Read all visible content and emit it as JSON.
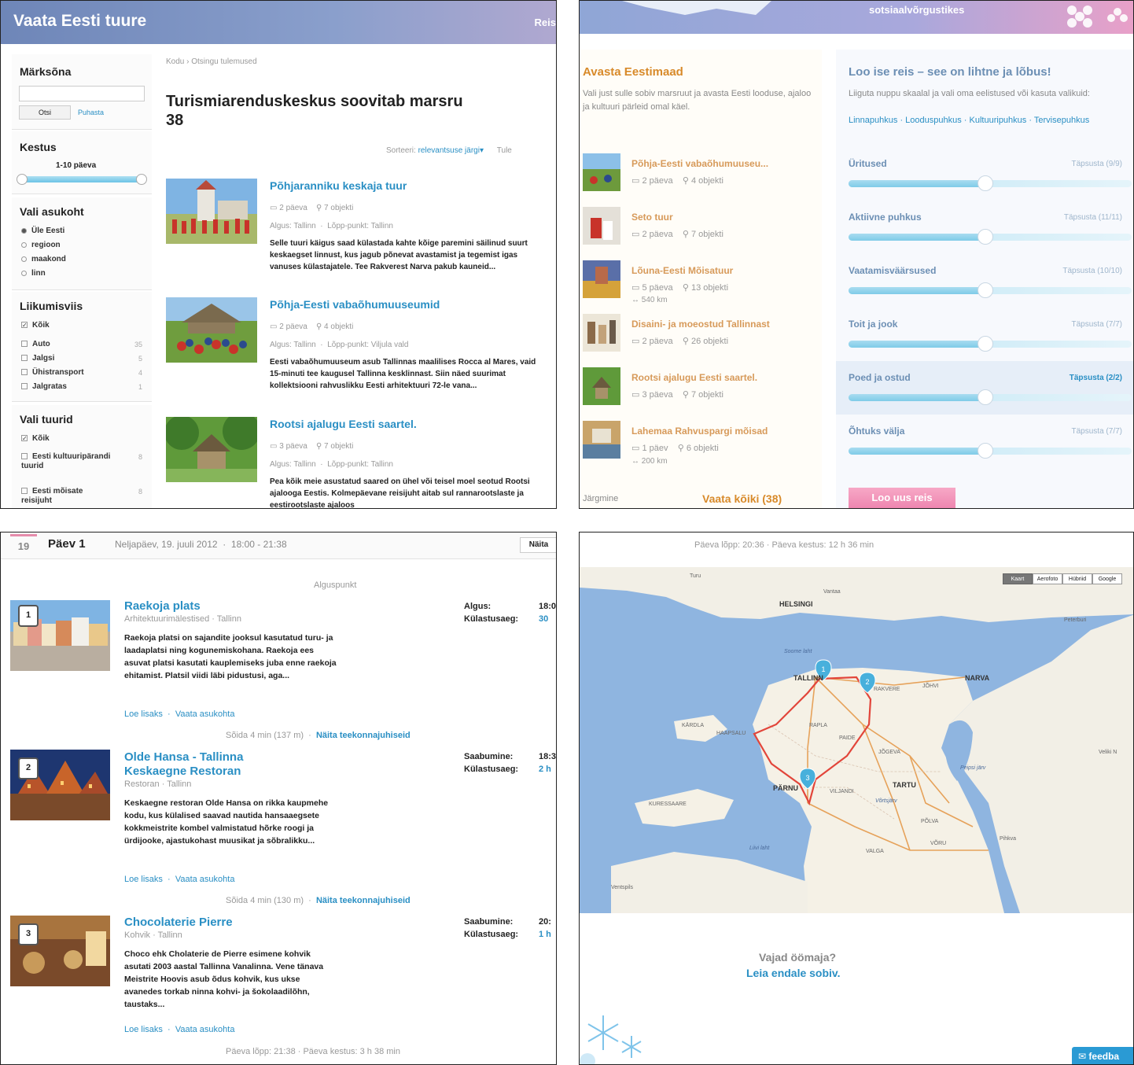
{
  "q1": {
    "banner_title": "Vaata Eesti tuure",
    "banner_right": "Reis",
    "sidebar": {
      "keyword_heading": "Märksõna",
      "search_button": "Otsi",
      "clear_link": "Puhasta",
      "duration_heading": "Kestus",
      "duration_value": "1-10 päeva",
      "location_heading": "Vali asukoht",
      "location_options": [
        "Üle Eesti",
        "regioon",
        "maakond",
        "linn"
      ],
      "transport_heading": "Liikumisviis",
      "transport_options": [
        {
          "label": "Kõik",
          "count": ""
        },
        {
          "label": "Auto",
          "count": "35"
        },
        {
          "label": "Jalgsi",
          "count": "5"
        },
        {
          "label": "Ühistransport",
          "count": "4"
        },
        {
          "label": "Jalgratas",
          "count": "1"
        }
      ],
      "tours_heading": "Vali tuurid",
      "tour_options": [
        {
          "label": "Kõik",
          "count": ""
        },
        {
          "label": "Eesti kultuuripärandi tuurid",
          "count": "8"
        },
        {
          "label": "Eesti mõisate reisijuht",
          "count": "8"
        }
      ]
    },
    "breadcrumb": [
      "Kodu",
      "Otsingu tulemused"
    ],
    "heading_line1": "Turismiarenduskeskus soovitab marsru",
    "heading_line2": "38",
    "sort_label": "Sorteeri:",
    "sort_value": "relevantsuse järgi",
    "sort_extra": "Tule",
    "tours": [
      {
        "title": "Põhjaranniku keskaja tuur",
        "days": "2 päeva",
        "objects": "7 objekti",
        "start": "Algus: Tallinn",
        "end": "Lõpp-punkt: Tallinn",
        "desc": "Selle tuuri käigus saad külastada kahte kõige paremini säilinud suurt keskaegset linnust, kus jagub põnevat avastamist ja tegemist igas vanuses külastajatele. Tee Rakverest Narva pakub kauneid..."
      },
      {
        "title": "Põhja-Eesti vabaõhumuuseumid",
        "days": "2 päeva",
        "objects": "4 objekti",
        "start": "Algus: Tallinn",
        "end": "Lõpp-punkt: Viljula vald",
        "desc": "Eesti vabaõhumuuseum asub Tallinnas maalilises Rocca al Mares, vaid 15-minuti tee kaugusel Tallinna kesklinnast. Siin näed suurimat kollektsiooni rahvuslikku Eesti arhitektuuri 72-le vana..."
      },
      {
        "title": "Rootsi ajalugu Eesti saartel.",
        "days": "3 päeva",
        "objects": "7 objekti",
        "start": "Algus: Tallinn",
        "end": "Lõpp-punkt: Tallinn",
        "desc": "Pea kõik meie asustatud saared on ühel või teisel moel seotud Rootsi ajalooga Eestis. Kolmepäevane reisijuht aitab sul rannarootslaste ja eestirootslaste ajaloos"
      }
    ]
  },
  "q2": {
    "banner_text": "sotsiaalvõrgustikes",
    "left_title": "Avasta Eestimaad",
    "left_desc": "Vali just sulle sobiv marsruut ja avasta Eesti looduse, ajaloo ja kultuuri pärleid omal käel.",
    "tours": [
      {
        "title": "Põhja-Eesti vabaõhumuuseu...",
        "days": "2 päeva",
        "objects": "4 objekti",
        "km": ""
      },
      {
        "title": "Seto tuur",
        "days": "2 päeva",
        "objects": "7 objekti",
        "km": ""
      },
      {
        "title": "Lõuna-Eesti Mõisatuur",
        "days": "5 päeva",
        "objects": "13 objekti",
        "km": "540 km"
      },
      {
        "title": "Disaini- ja moeostud Tallinnast",
        "days": "2 päeva",
        "objects": "26 objekti",
        "km": ""
      },
      {
        "title": "Rootsi ajalugu Eesti saartel.",
        "days": "3 päeva",
        "objects": "7 objekti",
        "km": ""
      },
      {
        "title": "Lahemaa Rahvuspargi mõisad",
        "days": "1 päev",
        "objects": "6 objekti",
        "km": "200 km"
      }
    ],
    "next_label": "Järgmine",
    "see_all": "Vaata kõiki (38)",
    "right_title": "Loo ise reis – see on lihtne ja lõbus!",
    "right_desc": "Liiguta nuppu skaalal ja vali oma eelistused või kasuta valikuid:",
    "quick_links": [
      "Linnapuhkus",
      "Looduspuhkus",
      "Kultuuripuhkus",
      "Tervisepuhkus"
    ],
    "categories": [
      {
        "name": "Üritused",
        "link": "Täpsusta (9/9)",
        "level": 0.5
      },
      {
        "name": "Aktiivne puhkus",
        "link": "Täpsusta (11/11)",
        "level": 0.5
      },
      {
        "name": "Vaatamisväärsused",
        "link": "Täpsusta (10/10)",
        "level": 0.5
      },
      {
        "name": "Toit ja jook",
        "link": "Täpsusta (7/7)",
        "level": 0.5
      },
      {
        "name": "Poed ja ostud",
        "link": "Täpsusta (2/2)",
        "level": 0.5
      },
      {
        "name": "Õhtuks välja",
        "link": "Täpsusta (7/7)",
        "level": 0.5
      }
    ],
    "create_button": "Loo uus reis"
  },
  "q3": {
    "day_num": "19",
    "day_label": "Päev 1",
    "day_date": "Neljapäev, 19. juuli 2012",
    "day_time": "18:00 - 21:38",
    "show_button": "Näita",
    "start_point": "Alguspunkt",
    "pois": [
      {
        "num": "1",
        "title1": "Raekoja plats",
        "title2": "",
        "sub": "Arhitektuurimälestised · Tallinn",
        "desc": "Raekoja platsi on sajandite jooksul kasutatud turu- ja laadaplatsi ning kogunemiskohana. Raekoja ees asuvat platsi kasutati kauplemiseks juba enne raekoja ehitamist. Platsil viidi läbi pidustusi, aga...",
        "read_more": "Loe lisaks",
        "see_location": "Vaata asukohta",
        "r1_label": "Algus:",
        "r1_val": "18:0",
        "r2_label": "Külastusaeg:",
        "r2_val": "30"
      },
      {
        "num": "2",
        "title1": "Olde Hansa - Tallinna",
        "title2": "Keskaegne Restoran",
        "sub": "Restoran · Tallinn",
        "desc": "Keskaegne restoran Olde Hansa on rikka kaupmehe kodu, kus külalised saavad nautida hansaaegsete kokkmeistrite kombel valmistatud hõrke roogi ja ürdijooke, ajastukohast muusikat ja sõbralikku...",
        "read_more": "Loe lisaks",
        "see_location": "Vaata asukohta",
        "r1_label": "Saabumine:",
        "r1_val": "18:3",
        "r2_label": "Külastusaeg:",
        "r2_val": "2 h"
      },
      {
        "num": "3",
        "title1": "Chocolaterie Pierre",
        "title2": "",
        "sub": "Kohvik · Tallinn",
        "desc": "Choco ehk Cholaterie de Pierre esimene kohvik asutati 2003 aastal Tallinna Vanalinna. Vene tänava Meistrite Hoovis asub õdus kohvik, kus ukse avanedes torkab ninna kohvi- ja šokolaadilõhn, taustaks...",
        "read_more": "Loe lisaks",
        "see_location": "Vaata asukohta",
        "r1_label": "Saabumine:",
        "r1_val": "20:",
        "r2_label": "Külastusaeg:",
        "r2_val": "1 h"
      }
    ],
    "walks": [
      {
        "text": "Sõida 4 min (137 m)",
        "link": "Näita teekonnajuhiseid"
      },
      {
        "text": "Sõida 4 min (130 m)",
        "link": "Näita teekonnajuhiseid"
      }
    ],
    "day_end": "Päeva lõpp: 21:38 · Päeva kestus: 3 h 38 min"
  },
  "q4": {
    "top_text": "Päeva lõpp: 20:36 · Päeva kestus: 12 h 36 min",
    "map_types": [
      "Kaart",
      "Aerofoto",
      "Hübriid",
      "Google"
    ],
    "cities_big": [
      "TALLINN",
      "NARVA",
      "TARTU",
      "PÄRNU",
      "HELSINGI"
    ],
    "cities_small": [
      "Turu",
      "Vantaa",
      "Peterburi",
      "RAKVERE",
      "JÕHVI",
      "KÄRDLA",
      "HAAPSALU",
      "RAPLA",
      "PAIDE",
      "JÕGEVA",
      "VILJANDI",
      "KURESSAARE",
      "PÕLVA",
      "VÕRU",
      "VALGA",
      "Pihkva",
      "Veliki N",
      "Ventspils",
      "Soome laht",
      "Liivi laht",
      "Peipsi järv",
      "Võrtsjärv"
    ],
    "markers": [
      "1",
      "2",
      "3"
    ],
    "lodging_question": "Vajad öömaja?",
    "lodging_link": "Leia endale sobiv.",
    "feedback": "feedba"
  }
}
